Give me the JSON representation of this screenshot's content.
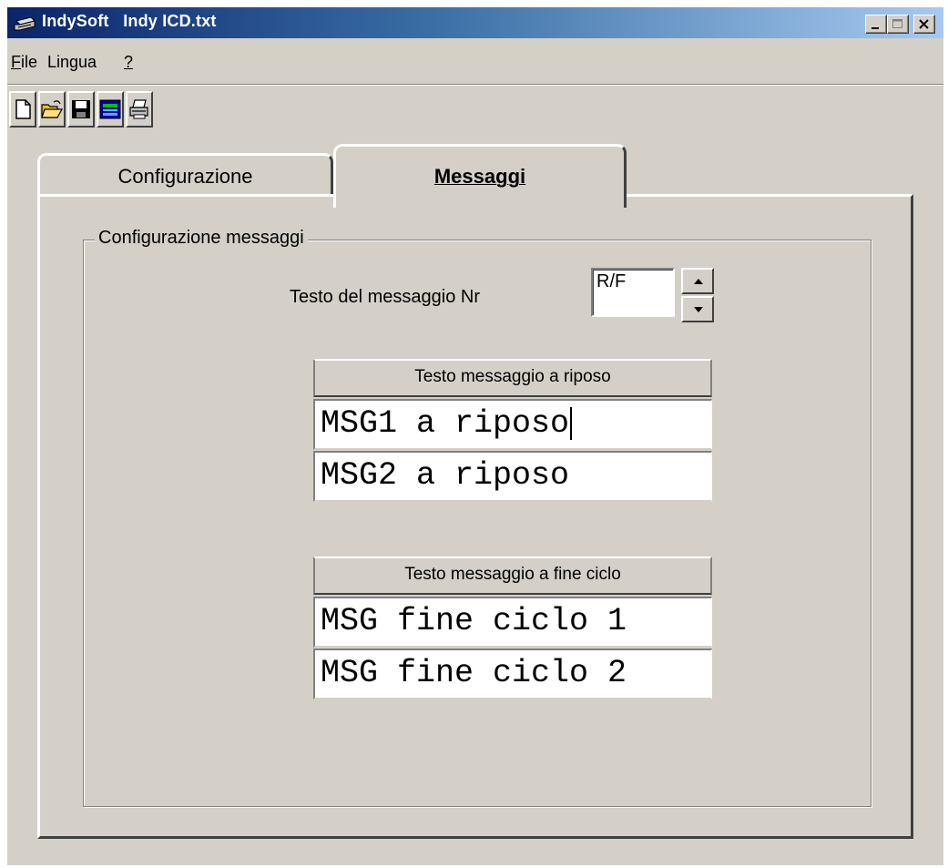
{
  "window": {
    "title": "IndySoft   Indy ICD.txt",
    "caption_buttons": [
      "minimize-icon",
      "maximize-icon",
      "close-icon"
    ]
  },
  "menu": {
    "items": [
      {
        "label": "File",
        "accelerator": "F"
      },
      {
        "label": "Lingua"
      },
      {
        "label": "?"
      }
    ]
  },
  "toolbar": {
    "buttons": [
      "new-file-icon",
      "open-folder-icon",
      "save-disk-icon",
      "display-panel-icon",
      "print-icon"
    ]
  },
  "tabs": [
    {
      "label": "Configurazione",
      "active": false
    },
    {
      "label": "Messaggi",
      "active": true
    }
  ],
  "messages": {
    "group_title": "Configurazione messaggi",
    "message_number_label": "Testo del messaggio Nr",
    "message_number_value": "R/F",
    "rest_header": "Testo messaggio a riposo",
    "rest_messages": [
      "MSG1 a riposo",
      "MSG2 a riposo"
    ],
    "end_header": "Testo messaggio a fine ciclo",
    "end_messages": [
      "MSG fine ciclo 1",
      "MSG fine ciclo 2"
    ]
  }
}
